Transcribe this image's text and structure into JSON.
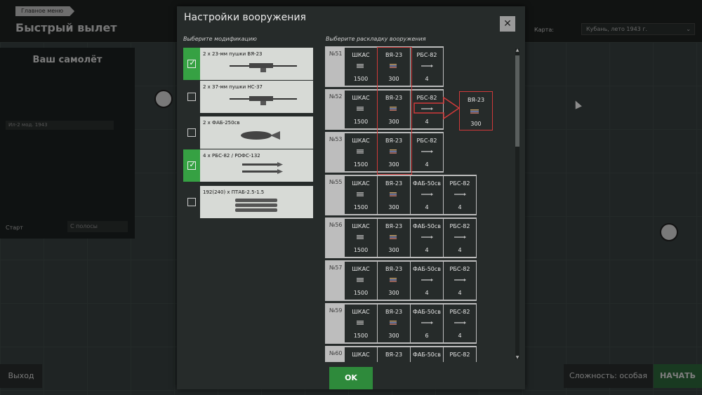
{
  "background": {
    "breadcrumb": "Главное меню",
    "app_title": "Быстрый вылет",
    "map_label": "Карта:",
    "map_value": "Кубань, лето 1943 г.",
    "plane_panel": {
      "title": "Ваш самолёт",
      "plane": "Ил-2 мод. 1943"
    },
    "start_label": "Старт",
    "start_value": "С полосы",
    "exit_button": "Выход",
    "difficulty_button": "Сложность: особая",
    "start_button": "НАЧАТЬ"
  },
  "modal": {
    "title": "Настройки вооружения",
    "close_icon": "close-icon",
    "mods_header": "Выберите модификацию",
    "loadouts_header": "Выберите раскладку вооружения",
    "ok": "OK"
  },
  "modifications": [
    {
      "label": "2 x 23-мм пушки ВЯ-23",
      "checked": true,
      "icon": "cannon-icon"
    },
    {
      "label": "2 x 37-мм пушки НС-37",
      "checked": false,
      "icon": "cannon-icon"
    },
    {
      "label": "2 x ФАБ-250св",
      "checked": false,
      "icon": "bomb-icon"
    },
    {
      "label": "4 x РБС-82 / РОФС-132",
      "checked": true,
      "icon": "rocket-icon"
    },
    {
      "label": "192(240) x ПТАБ-2.5-1.5",
      "checked": false,
      "icon": "cluster-bomb-icon"
    }
  ],
  "loadouts": [
    {
      "num": "№51",
      "items": [
        [
          "ШКАС",
          "1500"
        ],
        [
          "ВЯ-23",
          "300"
        ],
        [
          "РБС-82",
          "4"
        ]
      ]
    },
    {
      "num": "№52",
      "items": [
        [
          "ШКАС",
          "1500"
        ],
        [
          "ВЯ-23",
          "300"
        ],
        [
          "РБС-82",
          "4"
        ]
      ]
    },
    {
      "num": "№53",
      "items": [
        [
          "ШКАС",
          "1500"
        ],
        [
          "ВЯ-23",
          "300"
        ],
        [
          "РБС-82",
          "4"
        ]
      ]
    },
    {
      "num": "№55",
      "items": [
        [
          "ШКАС",
          "1500"
        ],
        [
          "ВЯ-23",
          "300"
        ],
        [
          "ФАБ-50св",
          "4"
        ],
        [
          "РБС-82",
          "4"
        ]
      ]
    },
    {
      "num": "№56",
      "items": [
        [
          "ШКАС",
          "1500"
        ],
        [
          "ВЯ-23",
          "300"
        ],
        [
          "ФАБ-50св",
          "4"
        ],
        [
          "РБС-82",
          "4"
        ]
      ]
    },
    {
      "num": "№57",
      "items": [
        [
          "ШКАС",
          "1500"
        ],
        [
          "ВЯ-23",
          "300"
        ],
        [
          "ФАБ-50св",
          "4"
        ],
        [
          "РБС-82",
          "4"
        ]
      ]
    },
    {
      "num": "№59",
      "items": [
        [
          "ШКАС",
          "1500"
        ],
        [
          "ВЯ-23",
          "300"
        ],
        [
          "ФАБ-50св",
          "6"
        ],
        [
          "РБС-82",
          "4"
        ]
      ]
    },
    {
      "num": "№60",
      "items": [
        [
          "ШКАС",
          ""
        ],
        [
          "ВЯ-23",
          ""
        ],
        [
          "ФАБ-50св",
          ""
        ],
        [
          "РБС-82",
          ""
        ]
      ]
    }
  ],
  "popout": {
    "name": "ВЯ-23",
    "count": "300"
  },
  "colors": {
    "accent_green": "#36a143",
    "highlight_red": "#d03a3a",
    "ok_green": "#2e8a3b"
  }
}
